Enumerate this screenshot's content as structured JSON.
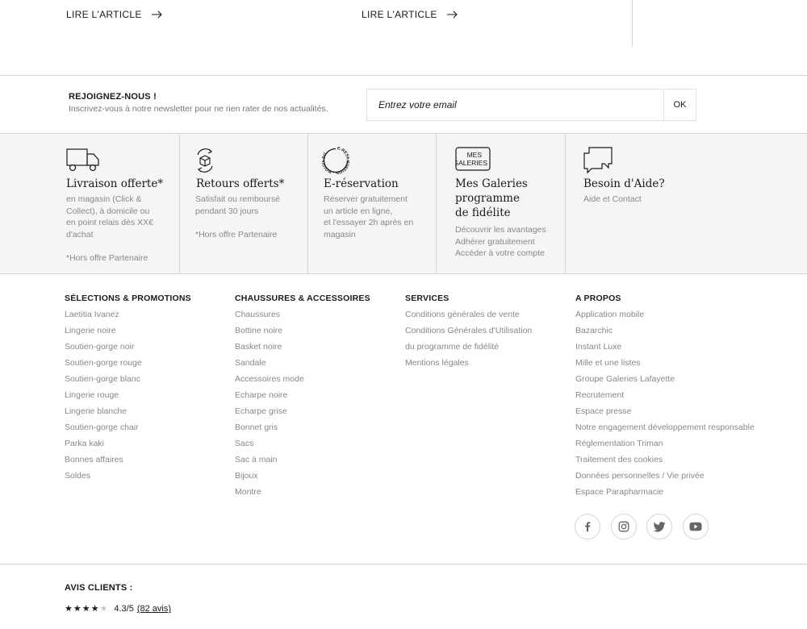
{
  "articles": [
    {
      "link_label": "LIRE L'ARTICLE"
    },
    {
      "link_label": "LIRE L'ARTICLE"
    }
  ],
  "newsletter": {
    "title": "REJOIGNEZ-NOUS !",
    "subtitle": "Inscrivez-vous à notre newsletter pour ne rien rater de nos actualités.",
    "placeholder": "Entrez votre email",
    "submit_label": "OK"
  },
  "services": [
    {
      "icon": "truck-icon",
      "title": "Livraison offerte*",
      "text": "en magasin (Click &\nCollect), à domicile ou\nen point relais dès XX€\nd'achat\n\n*Hors offre Partenaire"
    },
    {
      "icon": "return-box-icon",
      "title": "Retours offerts*",
      "text": "Satisfait ou remboursé\npendant 30 jours\n\n*Hors offre Partenaire"
    },
    {
      "icon": "reservation-icon",
      "icon_text": "E-RESERVATION · NOUVEAU",
      "title": "E-réservation",
      "text": "Réserver gratuitement\nun article en ligne,\net l'essayer 2h après en\nmagasin"
    },
    {
      "icon": "mes-galeries-icon",
      "icon_line1": "MES",
      "icon_line2": "GALERIES",
      "title": "Mes Galeries\nprogramme\nde fidélite",
      "text": "Découvrir les avantages\nAdhérer gratuitement\nAccéder à votre compte"
    },
    {
      "icon": "chat-bubbles-icon",
      "title": "Besoin d'Aide?",
      "text": "Aide et Contact"
    }
  ],
  "footer_columns": [
    {
      "title": "SÉLECTIONS & PROMOTIONS",
      "links": [
        "Laetitia Ivanez",
        "Lingerie noire",
        "Soutien-gorge noir",
        "Soutien-gorge rouge",
        "Soutien-gorge blanc",
        "Lingerie rouge",
        "Lingerie blanche",
        "Soutien-gorge chair",
        "Parka kaki",
        "Bonnes affaires",
        "Soldes"
      ]
    },
    {
      "title": "CHAUSSURES & ACCESSOIRES",
      "links": [
        "Chaussures",
        "Bottine noire",
        "Basket noire",
        "Sandale",
        "Accessoires mode",
        "Echarpe noire",
        "Echarpe grise",
        "Bonnet gris",
        "Sacs",
        "Sac à main",
        "Bijoux",
        "Montre"
      ]
    },
    {
      "title": "SERVICES",
      "links": [
        "Conditions générales de vente",
        "Conditions Générales d'Utilisation",
        "du programme de fidélité",
        "Mentions légales"
      ]
    },
    {
      "title": "A PROPOS",
      "links": [
        "Application mobile",
        "Bazarchic",
        "Instant Luxe",
        "Mille et une listes",
        "Groupe Galeries Lafayette",
        "Recrutement",
        "Espace presse",
        "Notre engagement développement responsable",
        "Réglementation Triman",
        "Traitement des cookies",
        "Données personnelles / Vie privée",
        "Espace Parapharmacie"
      ]
    }
  ],
  "social": [
    "facebook-icon",
    "instagram-icon",
    "twitter-icon",
    "youtube-icon"
  ],
  "reviews": {
    "title": "AVIS CLIENTS :",
    "rating": 4.3,
    "rating_text": "4.3/5",
    "count_text": "(82 avis)",
    "stars_filled": 4,
    "stars_total": 5
  }
}
